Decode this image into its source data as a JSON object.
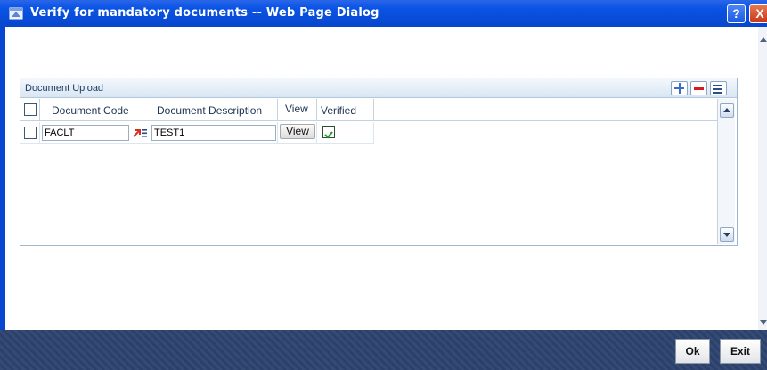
{
  "window": {
    "title": "Verify for mandatory documents -- Web Page Dialog",
    "help_label": "?",
    "close_label": "X"
  },
  "panel": {
    "title": "Document Upload",
    "columns": [
      "Document Code",
      "Document Description",
      "View",
      "Verified"
    ],
    "rows": [
      {
        "selected": false,
        "document_code": "FACLT",
        "document_description": "TEST1",
        "view_label": "View",
        "verified": true
      }
    ]
  },
  "footer": {
    "ok_label": "Ok",
    "exit_label": "Exit"
  },
  "colors": {
    "titlebar": "#0a54e6",
    "footer": "#2d4470",
    "panel_border": "#9eb6ce"
  }
}
